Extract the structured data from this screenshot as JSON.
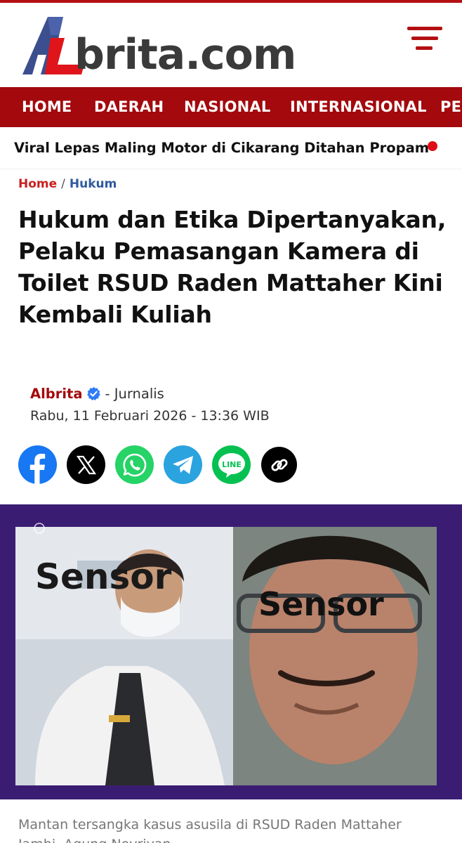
{
  "brand": {
    "logo_text": "brita.com",
    "logo_letter": "AL",
    "accent": "#a3090d",
    "accent_bright": "#e10d14",
    "link_blue": "#2d5a9e"
  },
  "nav": {
    "items": [
      "HOME",
      "DAERAH",
      "NASIONAL",
      "INTERNASIONAL",
      "PE"
    ]
  },
  "ticker": {
    "headline": "Viral Lepas Maling Motor di Cikarang Ditahan Propam"
  },
  "breadcrumb": {
    "home": "Home",
    "separator": "/",
    "category": "Hukum"
  },
  "article": {
    "title": "Hukum dan Etika Dipertanyakan, Pelaku Pemasangan Kamera di Toilet RSUD Raden Mattaher Kini Kembali Kuliah",
    "author": "Albrita",
    "author_role": "- Jurnalis",
    "date": "Rabu, 11 Februari 2026 - 13:36 WIB",
    "image_overlay_left": "Sensor",
    "image_overlay_right": "Sensor",
    "caption": "Mantan tersangka kasus asusila di RSUD Raden Mattaher Jambi, Agung Novriyan"
  },
  "share": {
    "buttons": [
      {
        "name": "facebook-icon",
        "color": "#1877f2"
      },
      {
        "name": "x-icon",
        "color": "#000000"
      },
      {
        "name": "whatsapp-icon",
        "color": "#25d366"
      },
      {
        "name": "telegram-icon",
        "color": "#2aa3df"
      },
      {
        "name": "line-icon",
        "color": "#06c152"
      },
      {
        "name": "copy-link-icon",
        "color": "#000000"
      }
    ],
    "line_label": "LINE"
  }
}
